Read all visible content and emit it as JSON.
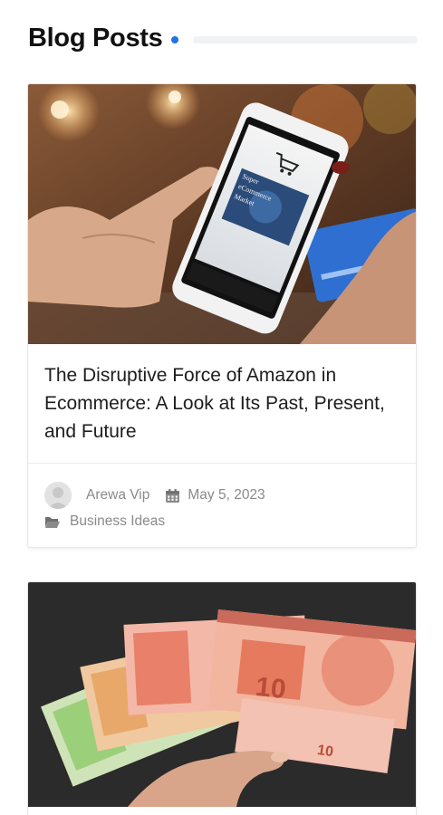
{
  "section": {
    "title": "Blog Posts"
  },
  "posts": [
    {
      "image": "smartphone-shopping-cart-image",
      "title": "The Disruptive Force of Amazon in Ecommerce: A Look at Its Past, Present, and Future",
      "author": "Arewa Vip",
      "date": "May 5, 2023",
      "category": "Business Ideas",
      "phone_screen_text": [
        "Super",
        "eCommerce",
        "Market"
      ]
    },
    {
      "image": "euro-banknotes-image"
    }
  ],
  "icons": {
    "accent_dot": "dot",
    "calendar": "calendar-icon",
    "folder": "folder-open-icon",
    "avatar": "user-avatar-icon"
  },
  "colors": {
    "accent": "#1e73e8",
    "meta_text": "#8a8a8a",
    "title_text": "#1d1d1d"
  }
}
